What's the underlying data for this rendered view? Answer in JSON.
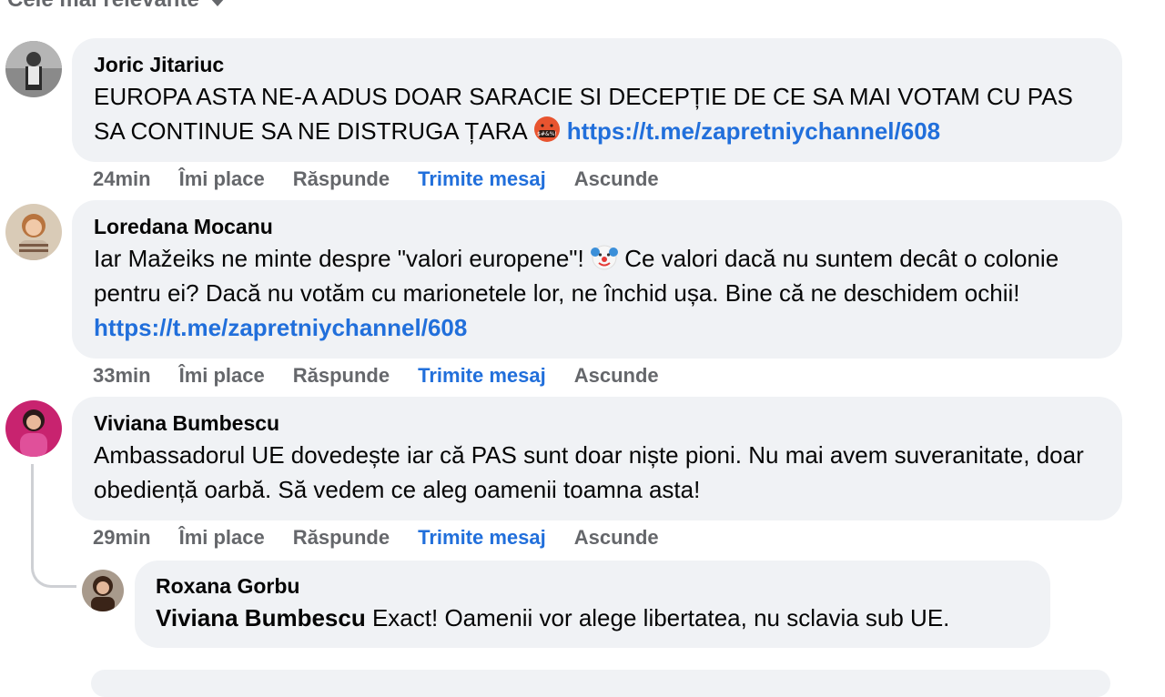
{
  "sort": {
    "label": "Cele mai relevante"
  },
  "comments": [
    {
      "author": "Joric Jitariuc",
      "text": "EUROPA ASTA NE-A ADUS DOAR SARACIE SI DECEPȚIE DE CE SA MAI VOTAM CU PAS SA CONTINUE SA NE DISTRUGA ȚARA",
      "emoji": "cursing-face-emoji",
      "link": "https://t.me/zapretniychannel/608",
      "time": "24min",
      "like": "Îmi place",
      "reply": "Răspunde",
      "message": "Trimite mesaj",
      "hide": "Ascunde"
    },
    {
      "author": "Loredana Mocanu",
      "text_before": "Iar Mažeiks ne minte despre \"valori europene\"!",
      "emoji": "clown-face-emoji",
      "text_after": "Ce valori dacă nu suntem decât o colonie pentru ei? Dacă nu votăm cu marionetele lor, ne închid ușa. Bine că ne deschidem ochii!",
      "link": "https://t.me/zapretniychannel/608",
      "time": "33min",
      "like": "Îmi place",
      "reply": "Răspunde",
      "message": "Trimite mesaj",
      "hide": "Ascunde"
    },
    {
      "author": "Viviana Bumbescu",
      "text": "Ambassadorul UE dovedește iar că PAS sunt doar niște pioni. Nu mai avem suveranitate, doar obediență oarbă. Să vedem ce aleg oamenii toamna asta!",
      "time": "29min",
      "like": "Îmi place",
      "reply": "Răspunde",
      "message": "Trimite mesaj",
      "hide": "Ascunde"
    }
  ],
  "reply": {
    "author": "Roxana Gorbu",
    "mention": "Viviana Bumbescu",
    "text": "Exact! Oamenii vor alege libertatea, nu sclavia sub UE."
  },
  "colors": {
    "link": "#216fdb",
    "muted": "#65676b",
    "bubble": "#f0f2f5"
  }
}
